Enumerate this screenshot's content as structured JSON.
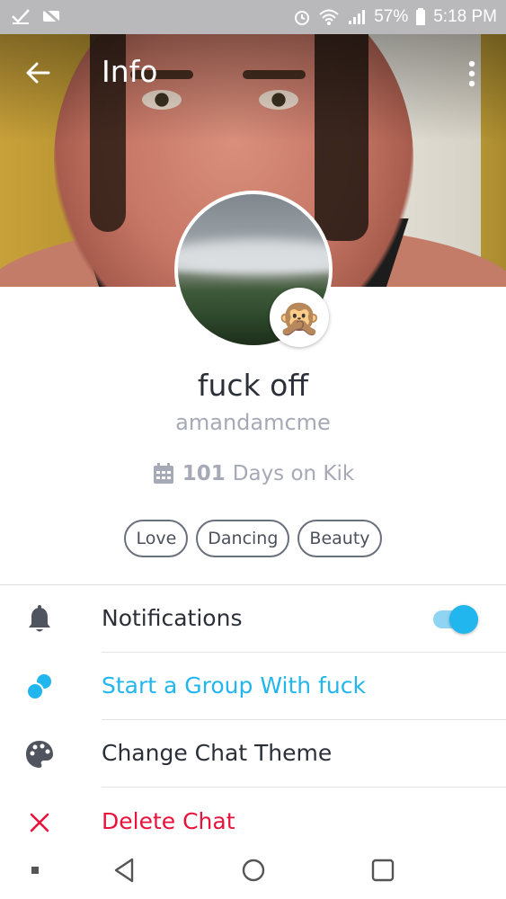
{
  "status_bar": {
    "battery": "57%",
    "time": "5:18 PM"
  },
  "header": {
    "title": "Info"
  },
  "profile": {
    "display_name": "fuck off",
    "username": "amandamcme",
    "days_count": "101",
    "days_label": "Days on Kik",
    "badge_emoji": "🙊",
    "tags": [
      "Love",
      "Dancing",
      "Beauty"
    ]
  },
  "menu": {
    "notifications": {
      "label": "Notifications",
      "enabled": true
    },
    "start_group": {
      "label": "Start a Group With fuck"
    },
    "change_theme": {
      "label": "Change Chat Theme"
    },
    "delete_chat": {
      "label": "Delete Chat"
    }
  },
  "colors": {
    "accent_blue": "#22b6ef",
    "danger_red": "#e8123c",
    "text_dark": "#2b2f38",
    "text_muted": "#a6a9b6"
  },
  "icons": {
    "back": "arrow-left-icon",
    "more": "more-vertical-icon",
    "calendar": "calendar-icon",
    "notifications": "bell-icon",
    "group": "group-bubbles-icon",
    "theme": "palette-icon",
    "delete": "close-x-icon"
  }
}
